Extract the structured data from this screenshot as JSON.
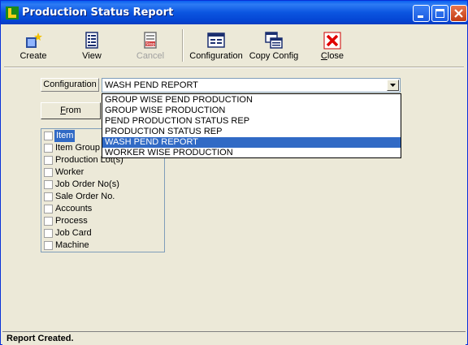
{
  "window": {
    "title": "Production Status Report",
    "controls": [
      "minimize",
      "maximize",
      "close"
    ]
  },
  "toolbar": {
    "create_label": "Create",
    "view_label": "View",
    "cancel_label": "Cancel",
    "configuration_label": "Configuration",
    "copy_config_label": "Copy Config",
    "close_label": "Close"
  },
  "config": {
    "label": "Configuration",
    "selected": "WASH PEND REPORT",
    "options": [
      "GROUP WISE PEND PRODUCTION",
      "GROUP WISE PRODUCTION",
      "PEND PRODUCTION STATUS REP",
      "PRODUCTION STATUS REP",
      "WASH PEND REPORT",
      "WORKER WISE PRODUCTION"
    ],
    "highlighted_index": 4
  },
  "from_button": {
    "label": "From",
    "underline_char": "F"
  },
  "filter_list": {
    "items": [
      "Item",
      "Item Group",
      "Production Lot(s)",
      "Worker",
      "Job Order No(s)",
      "Sale Order No.",
      "Accounts",
      "Process",
      "Job Card",
      "Machine"
    ],
    "selected_index": 0
  },
  "status": {
    "text": "Report Created."
  },
  "colors": {
    "titlebar": "#0a55e0",
    "selection": "#316ac5",
    "face": "#ece9d8"
  }
}
